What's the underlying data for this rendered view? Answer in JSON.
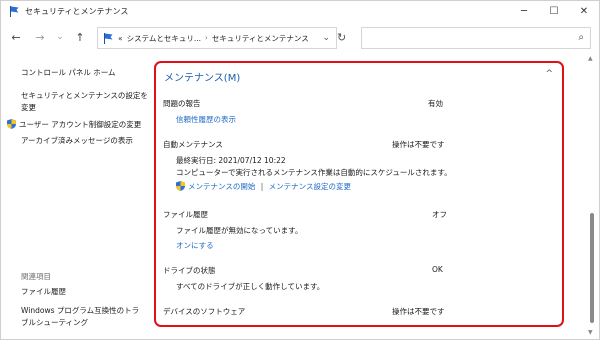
{
  "window": {
    "title": "セキュリティとメンテナンス",
    "minimize_glyph": "─",
    "maximize_glyph": "☐",
    "close_glyph": "✕"
  },
  "nav": {
    "back_glyph": "←",
    "forward_glyph": "→",
    "dropdown_glyph": "⌄",
    "up_glyph": "↑",
    "refresh_glyph": "↻"
  },
  "address": {
    "overflow": "«",
    "crumb1": "システムとセキュリ...",
    "separator": "›",
    "crumb2": "セキュリティとメンテナンス",
    "dropdown_glyph": "⌄"
  },
  "search": {
    "icon_glyph": "⌕"
  },
  "sidebar": {
    "home": "コントロール パネル ホーム",
    "change_settings_line1": "セキュリティとメンテナンスの設定を",
    "change_settings_line2": "変更",
    "uac": "ユーザー アカウント制御設定の変更",
    "archived": "アーカイブ済みメッセージの表示",
    "related_heading": "関連項目",
    "file_history": "ファイル履歴",
    "compat_line1": "Windows プログラム互換性のトラ",
    "compat_line2": "ブルシューティング"
  },
  "maintenance": {
    "title": "メンテナンス(M)",
    "collapse_glyph": "^",
    "problem_reports": {
      "label": "問題の報告",
      "status": "有効",
      "link": "信頼性履歴の表示"
    },
    "auto_maintenance": {
      "label": "自動メンテナンス",
      "status": "操作は不要です",
      "last_run": "最終実行日: 2021/07/12 10:22",
      "desc": "コンピューターで実行されるメンテナンス作業は自動的にスケジュールされます。",
      "start_link": "メンテナンスの開始",
      "link_sep": "|",
      "settings_link": "メンテナンス設定の変更"
    },
    "file_history": {
      "label": "ファイル履歴",
      "status": "オフ",
      "desc": "ファイル履歴が無効になっています。",
      "link": "オンにする"
    },
    "drive_status": {
      "label": "ドライブの状態",
      "status": "OK",
      "desc": "すべてのドライブが正しく動作しています。"
    },
    "device_software": {
      "label": "デバイスのソフトウェア",
      "status": "操作は不要です"
    }
  },
  "scrollbar": {
    "up_glyph": "▲",
    "down_glyph": "▼"
  },
  "colors": {
    "highlight_border": "#e01018",
    "link": "#1f6cc7",
    "section_title": "#1b5fa8"
  }
}
